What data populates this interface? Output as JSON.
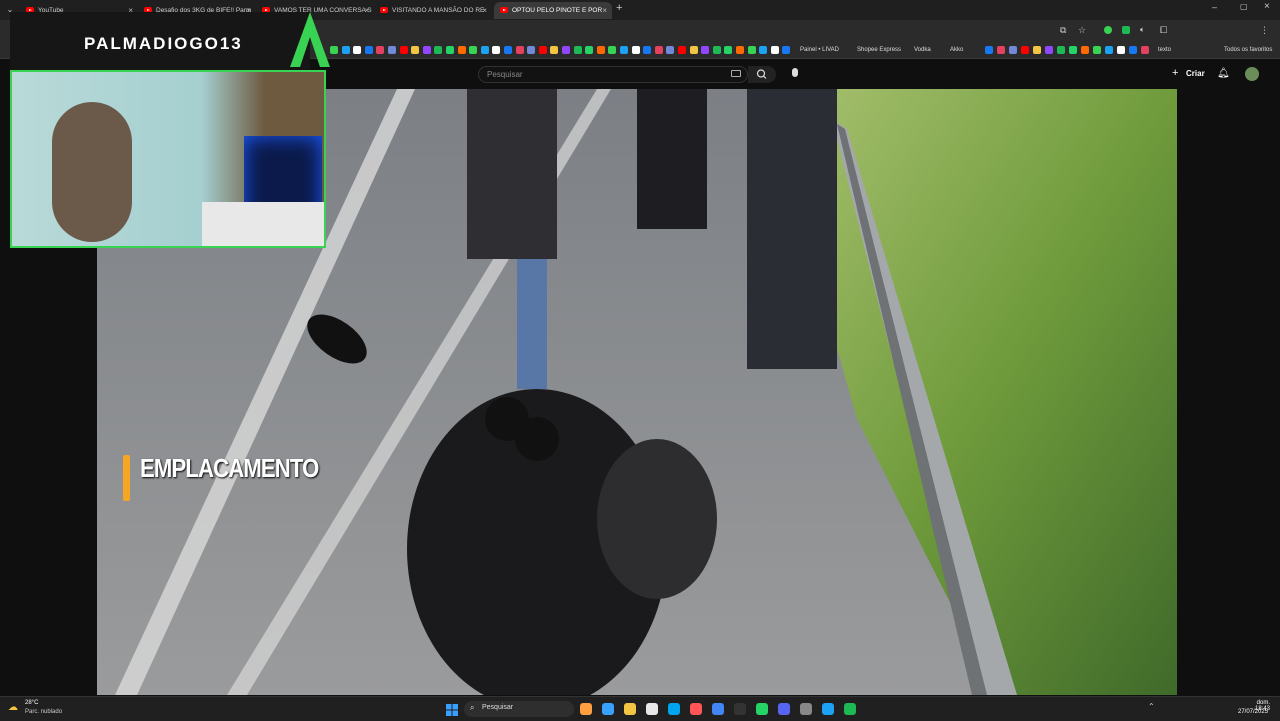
{
  "browser": {
    "tabs": [
      {
        "label": "YouTube",
        "active": false
      },
      {
        "label": "Desafio dos 3KG de BIFE!! Parm",
        "active": false
      },
      {
        "label": "VAMOS TER UMA CONVERSA S",
        "active": false
      },
      {
        "label": "VISITANDO A MANSÃO DO RE",
        "active": false
      },
      {
        "label": "OPTOU PELO PINOTE E POR",
        "active": true
      }
    ],
    "new_tab": "+",
    "bookmarks": {
      "painel": "Painel • LIVAD",
      "shopee": "Shopee Express",
      "vodka": "Vodka",
      "akko": "Akko",
      "texto": "texto",
      "todos": "Todos os favoritos"
    }
  },
  "youtube": {
    "search_placeholder": "Pesquisar",
    "create_label": "Criar"
  },
  "overlay": {
    "streamer_name": "PALMADIOGO13",
    "caption": "EMPLACAMENTO"
  },
  "taskbar": {
    "weather_temp": "28°C",
    "weather_desc": "Parc. nublado",
    "search_label": "Pesquisar",
    "day": "dom.",
    "time": "18:43",
    "date": "27/07/2025"
  },
  "colors": {
    "accent_green": "#39d353",
    "caption_bar": "#f5a623",
    "yt_red": "#ff0000"
  }
}
